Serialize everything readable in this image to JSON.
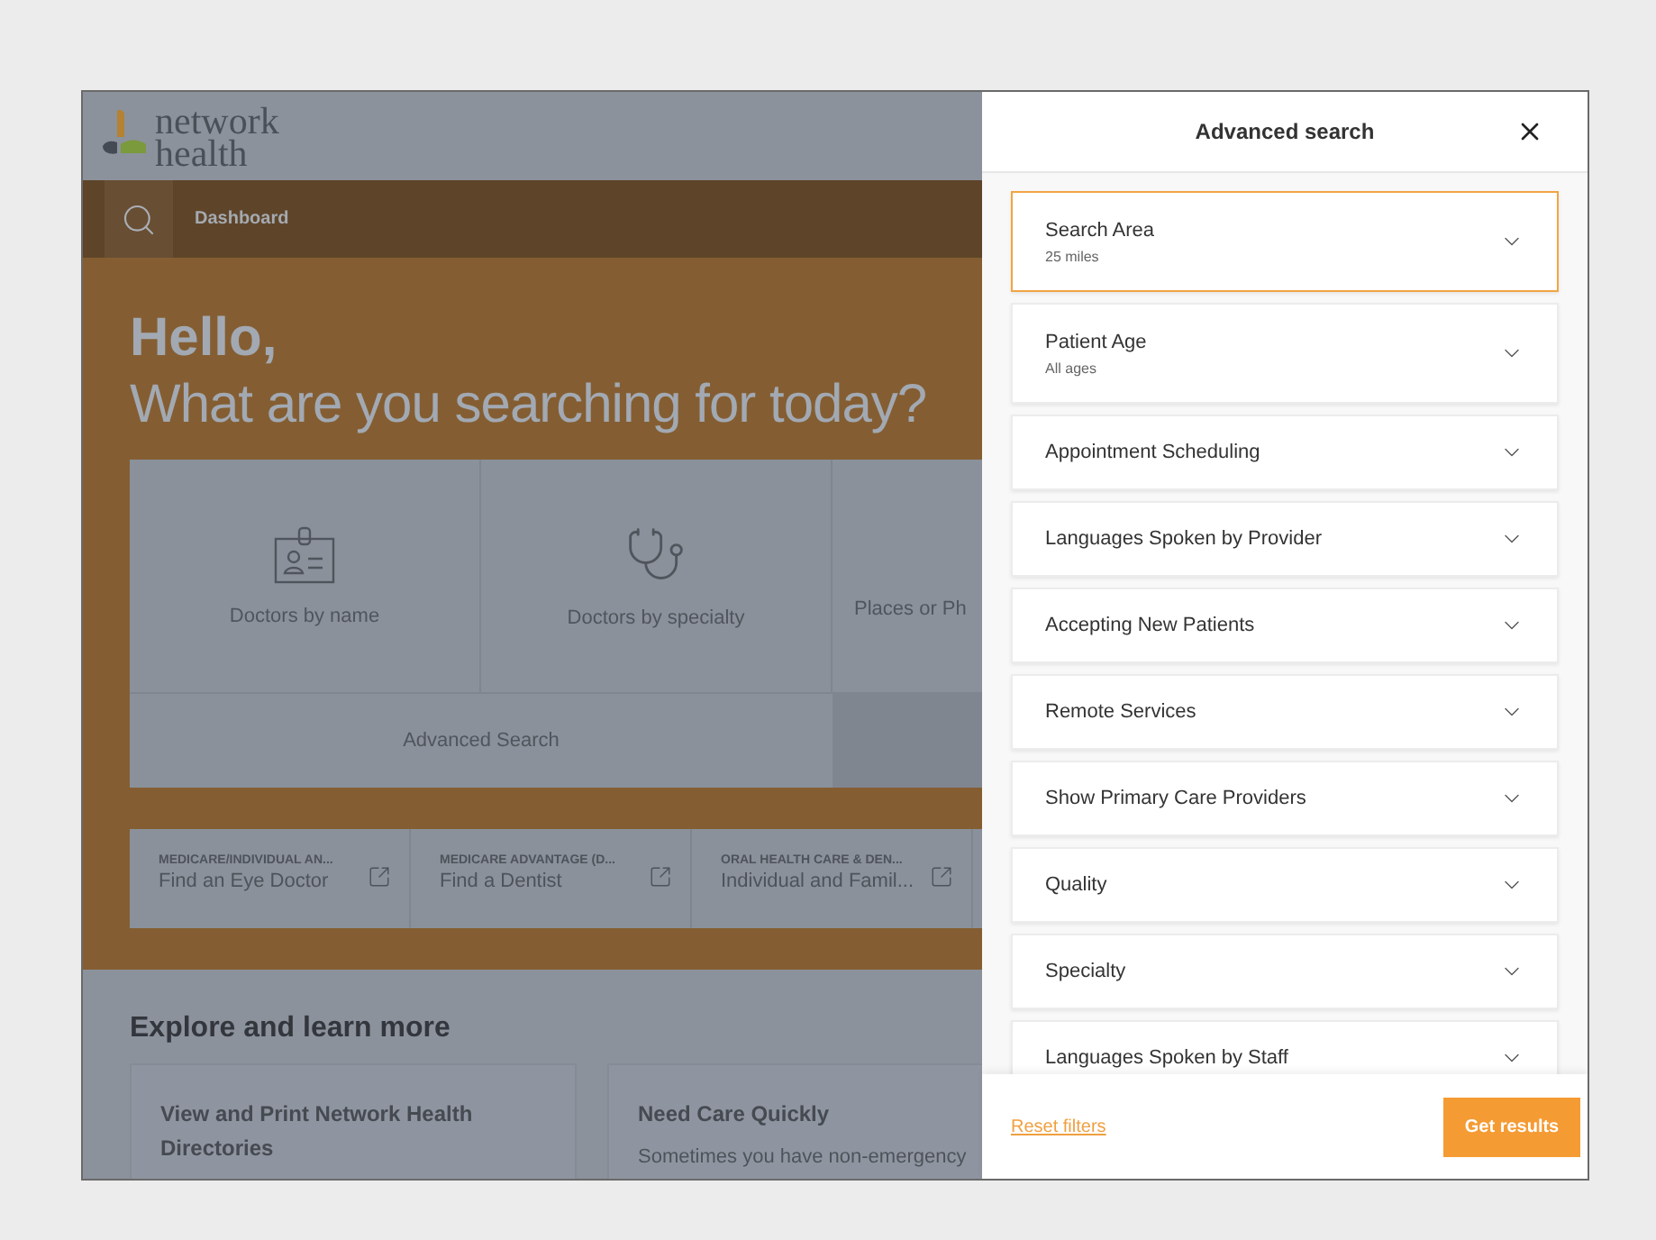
{
  "logo": {
    "line_1": "network",
    "line_2": "health"
  },
  "nav": {
    "items": [
      {
        "label": "Dashboard",
        "selected": true
      }
    ]
  },
  "hero": {
    "greeting": "Hello,",
    "question": "What are you searching for today?",
    "tiles": [
      {
        "label": "Doctors by name",
        "kind": "badge"
      },
      {
        "label": "Doctors by specialty",
        "kind": "stethoscope"
      },
      {
        "label": "Places or Ph",
        "kind": "none"
      }
    ],
    "advanced_search": "Advanced Search",
    "links": [
      {
        "category": "MEDICARE/INDIVIDUAL AN...",
        "title": "Find an Eye Doctor"
      },
      {
        "category": "MEDICARE ADVANTAGE (D...",
        "title": "Find a Dentist"
      },
      {
        "category": "ORAL HEALTH CARE & DEN...",
        "title": "Individual and Famil..."
      }
    ]
  },
  "explore": {
    "heading": "Explore and learn more",
    "cards": [
      {
        "title": "View and Print Network Health Directories"
      },
      {
        "title": "Need Care Quickly",
        "text": "Sometimes you have non-emergency"
      }
    ]
  },
  "drawer": {
    "title": "Advanced search",
    "filters": [
      {
        "label": "Search Area",
        "value": "25 miles",
        "selected": true
      },
      {
        "label": "Patient Age",
        "value": "All ages",
        "selected": false
      },
      {
        "label": "Appointment Scheduling",
        "selected": false
      },
      {
        "label": "Languages Spoken by Provider",
        "selected": false
      },
      {
        "label": "Accepting New Patients",
        "selected": false
      },
      {
        "label": "Remote Services",
        "selected": false
      },
      {
        "label": "Show Primary Care Providers",
        "selected": false
      },
      {
        "label": "Quality",
        "selected": false
      },
      {
        "label": "Specialty",
        "selected": false
      },
      {
        "label": "Languages Spoken by Staff",
        "selected": false
      }
    ],
    "reset": "Reset filters",
    "submit": "Get results"
  }
}
